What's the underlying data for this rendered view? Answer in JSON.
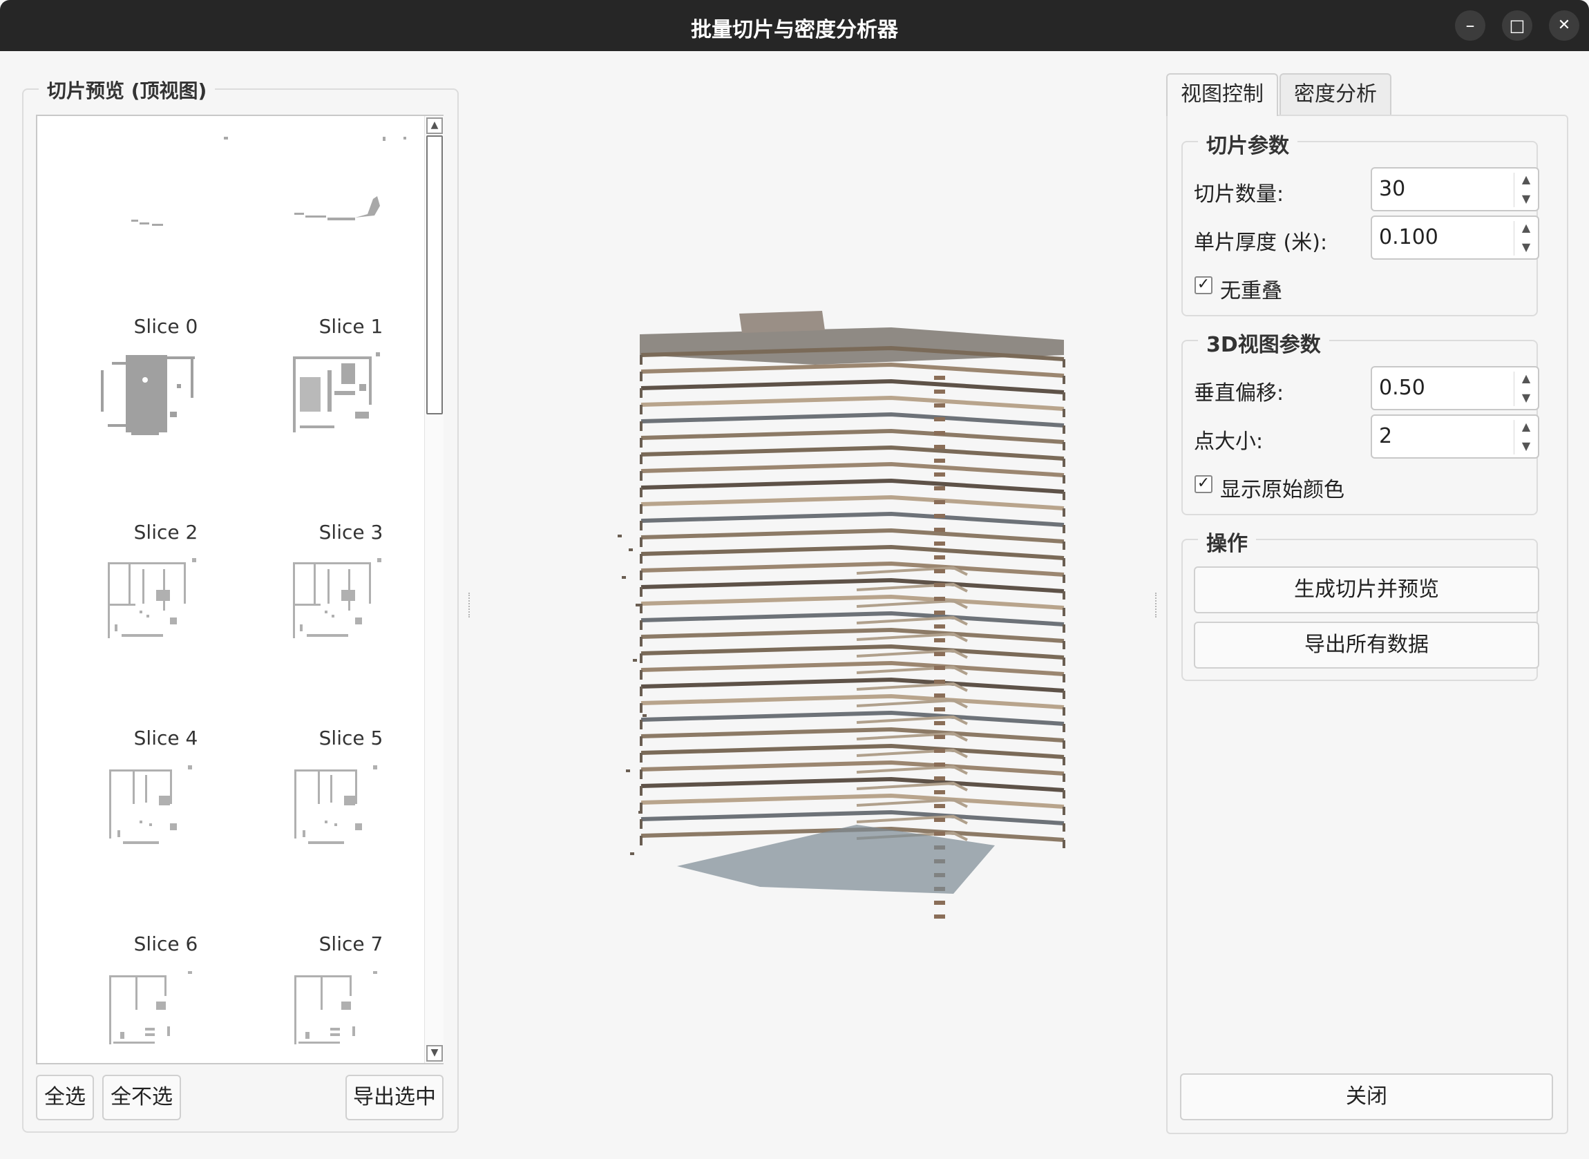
{
  "window": {
    "title": "批量切片与密度分析器",
    "minimize_icon": "minimize-icon",
    "maximize_icon": "maximize-icon",
    "close_icon": "close-icon",
    "minimize_glyph": "–",
    "maximize_glyph": "□",
    "close_glyph": "✕"
  },
  "left_panel": {
    "title": "切片预览 (顶视图)",
    "slices": [
      {
        "label": "Slice 0"
      },
      {
        "label": "Slice 1"
      },
      {
        "label": "Slice 2"
      },
      {
        "label": "Slice 3"
      },
      {
        "label": "Slice 4"
      },
      {
        "label": "Slice 5"
      },
      {
        "label": "Slice 6"
      },
      {
        "label": "Slice 7"
      },
      {
        "label": ""
      },
      {
        "label": ""
      }
    ],
    "buttons": {
      "select_all": "全选",
      "select_none": "全不选",
      "export_selected": "导出选中"
    },
    "scroll_up_glyph": "▲",
    "scroll_down_glyph": "▼"
  },
  "tabs": [
    {
      "label": "视图控制",
      "active": true
    },
    {
      "label": "密度分析",
      "active": false
    }
  ],
  "slice_params": {
    "title": "切片参数",
    "count_label": "切片数量:",
    "count_value": "30",
    "thickness_label": "单片厚度 (米):",
    "thickness_value": "0.100",
    "no_overlap_label": "无重叠",
    "no_overlap_checked": true
  },
  "view3d_params": {
    "title": "3D视图参数",
    "vertical_offset_label": "垂直偏移:",
    "vertical_offset_value": "0.50",
    "point_size_label": "点大小:",
    "point_size_value": "2",
    "show_color_label": "显示原始颜色",
    "show_color_checked": true
  },
  "actions": {
    "title": "操作",
    "generate_label": "生成切片并预览",
    "export_all_label": "导出所有数据"
  },
  "close_label": "关闭",
  "spin_up_glyph": "▲",
  "spin_down_glyph": "▼",
  "check_glyph": "✓"
}
